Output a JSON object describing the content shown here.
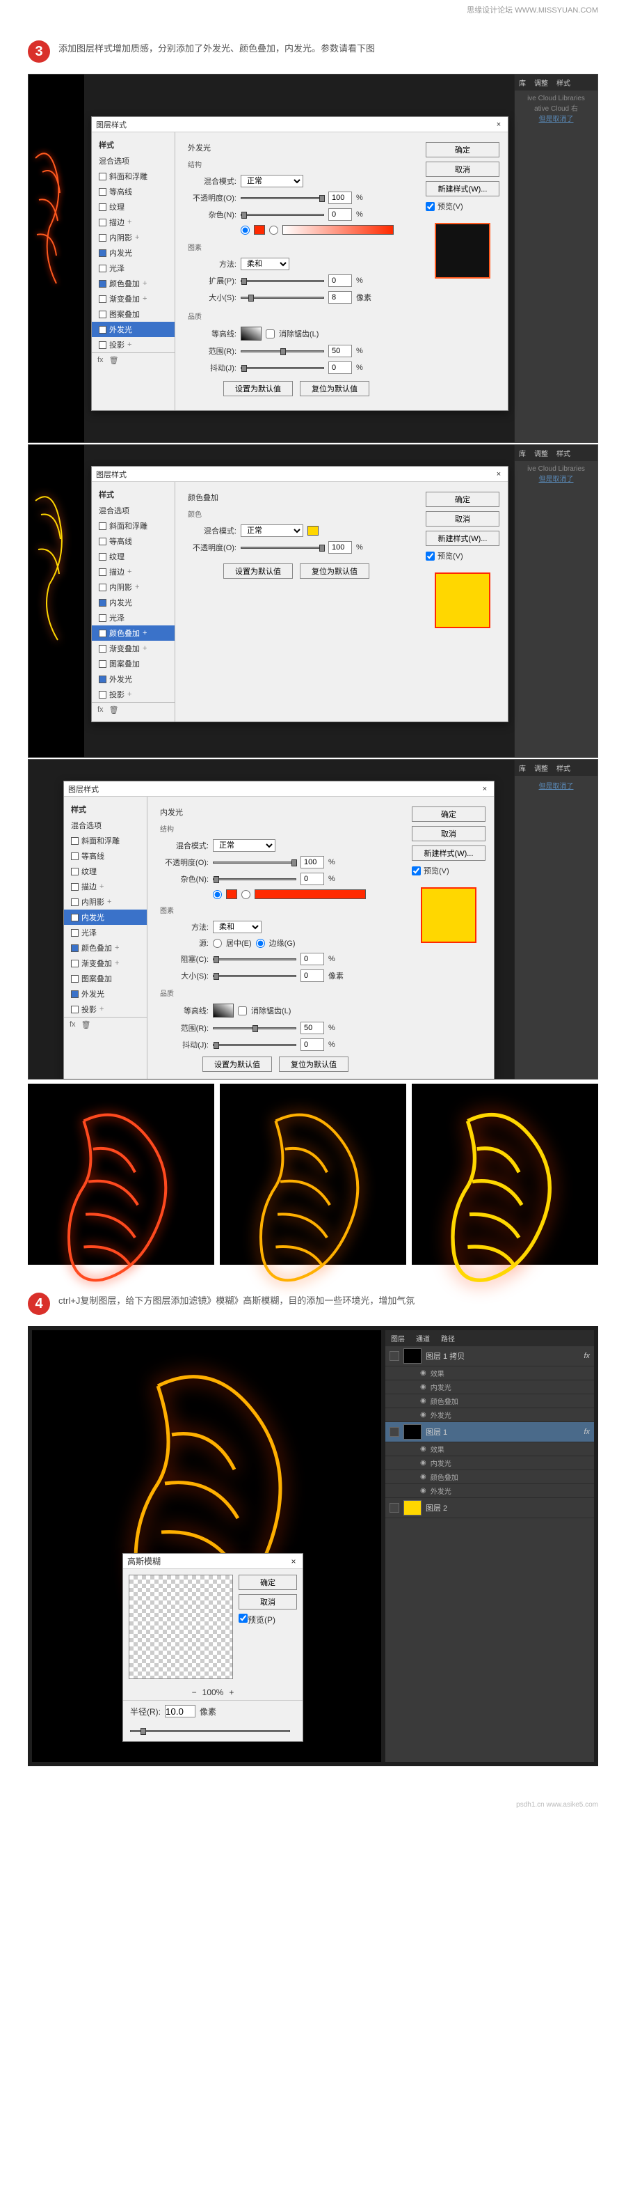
{
  "watermark_header": "思缘设计论坛  WWW.MISSYUAN.COM",
  "watermark_footer": "psdh1.cn  www.asike5.com",
  "step3": {
    "num": "3",
    "text": "添加图层样式增加质感，分别添加了外发光、颜色叠加，内发光。参数请看下图"
  },
  "step4": {
    "num": "4",
    "text": "ctrl+J复制图层，给下方图层添加滤镜》模糊》高斯模糊，目的添加一些环境光，增加气氛"
  },
  "dlg_common": {
    "title": "图层样式",
    "close": "×",
    "styles_header": "样式",
    "blend_opts": "混合选项",
    "bevel": "斜面和浮雕",
    "contour": "等高线",
    "texture": "纹理",
    "stroke": "描边",
    "inner_shadow": "内阴影",
    "inner_glow": "内发光",
    "satin": "光泽",
    "color_overlay": "颜色叠加",
    "gradient_overlay": "渐变叠加",
    "pattern_overlay": "图案叠加",
    "outer_glow": "外发光",
    "drop_shadow": "投影",
    "fx_label": "fx",
    "plus": "+",
    "btn_ok": "确定",
    "btn_cancel": "取消",
    "btn_new_style": "新建样式(W)...",
    "chk_preview": "预览(V)"
  },
  "panel_a": {
    "section_title": "外发光",
    "group_struct": "结构",
    "blend_mode_label": "混合模式:",
    "blend_mode_value": "正常",
    "opacity_label": "不透明度(O):",
    "opacity_value": "100",
    "pct": "%",
    "noise_label": "杂色(N):",
    "noise_value": "0",
    "group_elem": "图素",
    "method_label": "方法:",
    "method_value": "柔和",
    "spread_label": "扩展(P):",
    "spread_value": "0",
    "size_label": "大小(S):",
    "size_value": "8",
    "px": "像素",
    "group_quality": "品质",
    "contour_label": "等高线:",
    "antialias": "消除锯齿(L)",
    "range_label": "范围(R):",
    "range_value": "50",
    "jitter_label": "抖动(J):",
    "jitter_value": "0",
    "btn_default": "设置为默认值",
    "btn_reset": "复位为默认值"
  },
  "panel_b": {
    "section_title": "颜色叠加",
    "group_color": "颜色",
    "blend_mode_label": "混合模式:",
    "blend_mode_value": "正常",
    "opacity_label": "不透明度(O):",
    "opacity_value": "100",
    "pct": "%",
    "btn_default": "设置为默认值",
    "btn_reset": "复位为默认值"
  },
  "panel_c": {
    "section_title": "内发光",
    "group_struct": "结构",
    "blend_mode_label": "混合模式:",
    "blend_mode_value": "正常",
    "opacity_label": "不透明度(O):",
    "opacity_value": "100",
    "pct": "%",
    "noise_label": "杂色(N):",
    "noise_value": "0",
    "group_elem": "图素",
    "method_label": "方法:",
    "method_value": "柔和",
    "source_label": "源:",
    "source_center": "居中(E)",
    "source_edge": "边缘(G)",
    "choke_label": "阻塞(C):",
    "choke_value": "0",
    "size_label": "大小(S):",
    "size_value": "0",
    "px": "像素",
    "group_quality": "品质",
    "contour_label": "等高线:",
    "antialias": "消除锯齿(L)",
    "range_label": "范围(R):",
    "range_value": "50",
    "jitter_label": "抖动(J):",
    "jitter_value": "0",
    "btn_default": "设置为默认值",
    "btn_reset": "复位为默认值"
  },
  "ps_side": {
    "tab_lib": "库",
    "tab_adjust": "调整",
    "tab_styles": "样式",
    "cc_msg": "ive Cloud Libraries",
    "cc_msg2": "ative Cloud 右",
    "cc_link": "但是取消了"
  },
  "layers_panel": {
    "tab_layers": "图层",
    "tab_channels": "通道",
    "tab_paths": "路径",
    "layer_copy": "图层 1 拷贝",
    "layer1": "图层 1",
    "fx": "fx",
    "fx_list": "效果",
    "fx_inner_glow": "内发光",
    "fx_color_overlay": "颜色叠加",
    "fx_outer_glow": "外发光",
    "layer_bg": "图层 2",
    "eye_tip": "◉"
  },
  "gauss": {
    "title": "高斯模糊",
    "ok": "确定",
    "cancel": "取消",
    "preview": "预览(P)",
    "zoom": "100%",
    "radius_label": "半径(R):",
    "radius_value": "10.0",
    "px": "像素",
    "minus": "−",
    "plus": "+"
  },
  "colors": {
    "accent": "#d9302a",
    "neon": "#ff5a1f",
    "yellow": "#ffd700"
  }
}
